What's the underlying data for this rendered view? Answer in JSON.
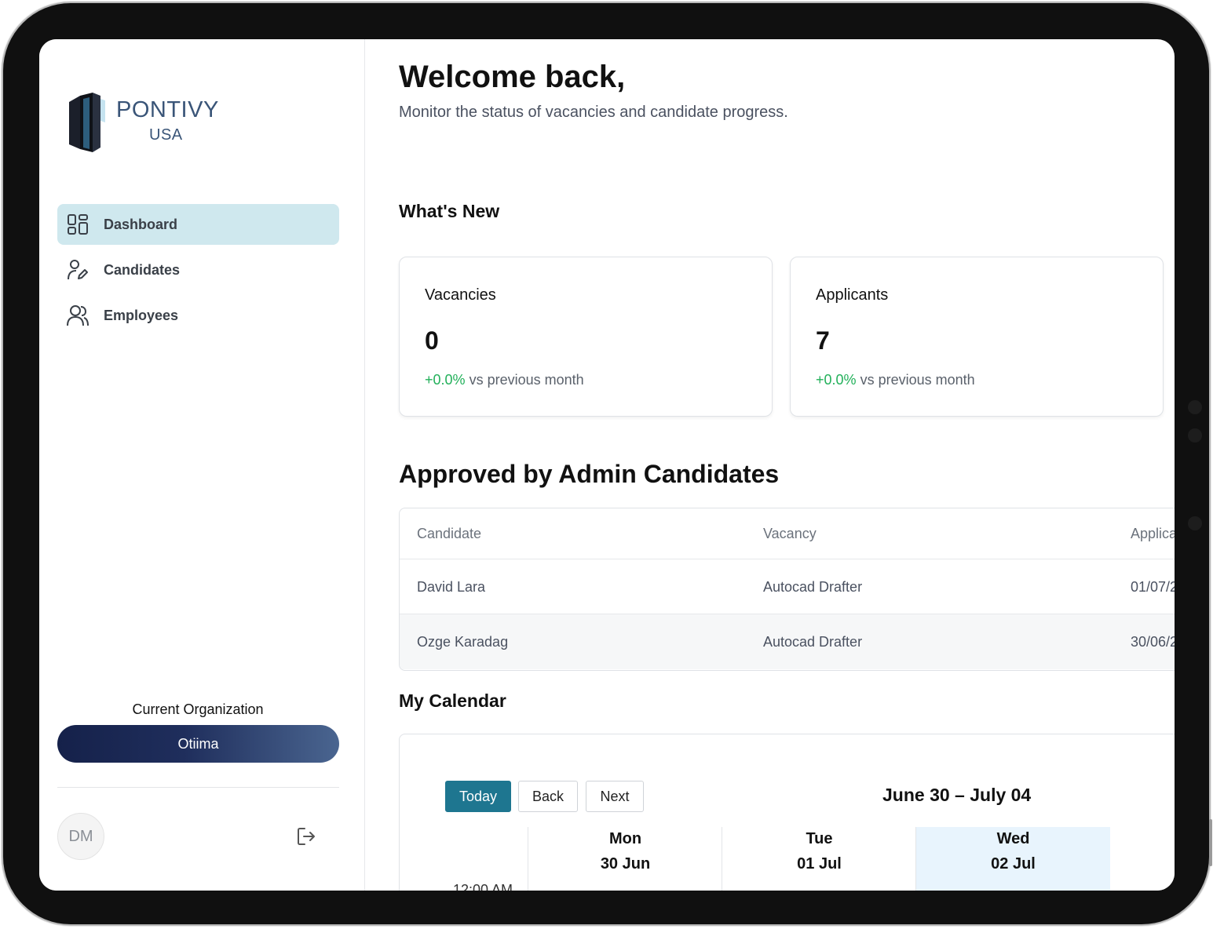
{
  "brand": {
    "name": "PONTIVY",
    "region": "USA"
  },
  "sidebar": {
    "items": [
      {
        "label": "Dashboard",
        "icon": "grid-icon",
        "active": true
      },
      {
        "label": "Candidates",
        "icon": "user-edit-icon",
        "active": false
      },
      {
        "label": "Employees",
        "icon": "users-icon",
        "active": false
      }
    ],
    "org_label": "Current Organization",
    "org_value": "Otiima",
    "avatar_initials": "DM",
    "logout_icon": "logout-icon"
  },
  "header": {
    "title": "Welcome back,",
    "subtitle": "Monitor the status of vacancies and candidate progress."
  },
  "whats_new": {
    "title": "What's New",
    "cards": [
      {
        "title": "Vacancies",
        "value": "0",
        "trend_pct": "+0.0%",
        "trend_text": "vs previous month"
      },
      {
        "title": "Applicants",
        "value": "7",
        "trend_pct": "+0.0%",
        "trend_text": "vs previous month"
      }
    ]
  },
  "approved": {
    "title": "Approved by Admin Candidates",
    "columns": [
      "Candidate",
      "Vacancy",
      "Applica"
    ],
    "rows": [
      [
        "David Lara",
        "Autocad Drafter",
        "01/07/2"
      ],
      [
        "Ozge Karadag",
        "Autocad Drafter",
        "30/06/2"
      ]
    ]
  },
  "calendar": {
    "title": "My Calendar",
    "buttons": {
      "today": "Today",
      "back": "Back",
      "next": "Next"
    },
    "range": "June 30 – July 04",
    "days": [
      {
        "name": "Mon",
        "date": "30 Jun",
        "highlight": false
      },
      {
        "name": "Tue",
        "date": "01 Jul",
        "highlight": false
      },
      {
        "name": "Wed",
        "date": "02 Jul",
        "highlight": true
      }
    ],
    "first_time": "12:00 AM"
  },
  "colors": {
    "accent": "#1e7690",
    "active_nav": "#cfe8ee",
    "positive": "#22b05a",
    "org_gradient_start": "#15214a",
    "org_gradient_end": "#4a6590"
  }
}
